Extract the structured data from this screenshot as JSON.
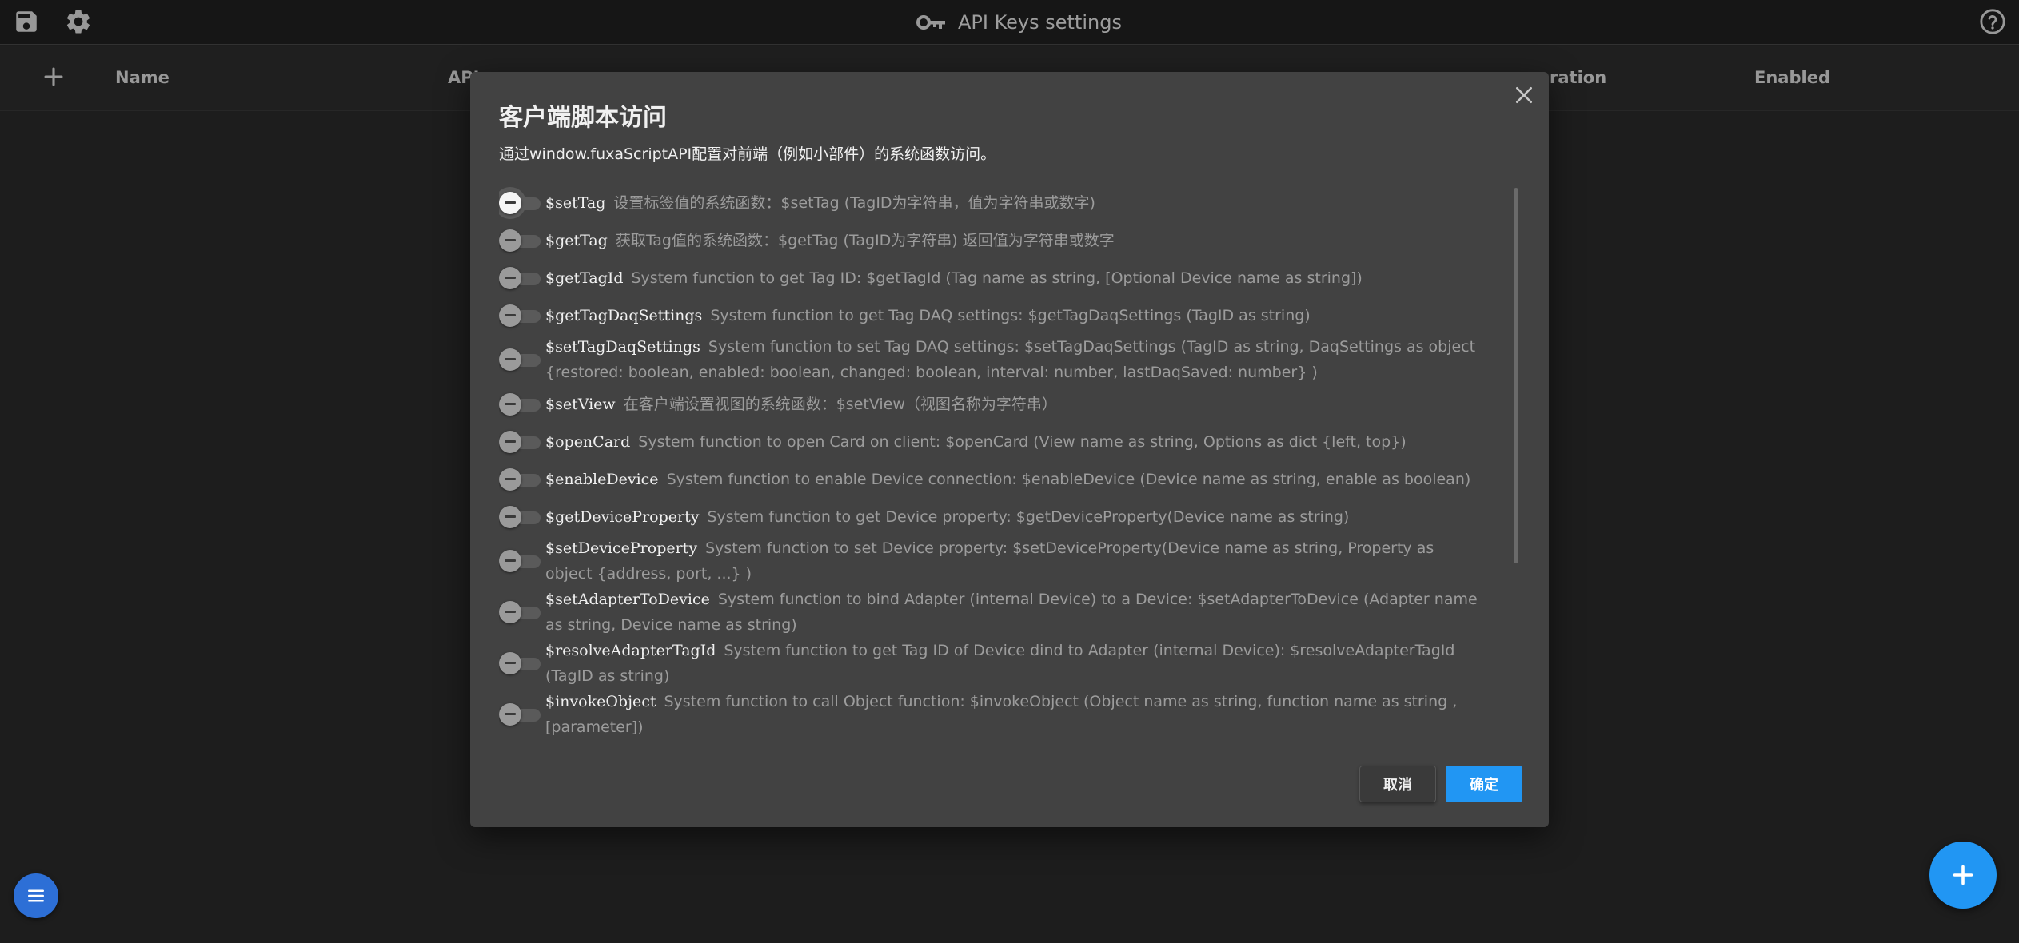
{
  "header": {
    "title": "API Keys settings",
    "icons": [
      "save-icon",
      "gear-icon",
      "key-icon",
      "help-icon"
    ]
  },
  "table": {
    "columns": [
      "Name",
      "API",
      "ration",
      "Enabled"
    ],
    "add_icon": "plus-icon"
  },
  "dialog": {
    "title": "客户端脚本访问",
    "description": "通过window.fuxaScriptAPI配置对前端（例如小部件）的系统函数访问。",
    "items": [
      {
        "name": "$setTag",
        "desc": "设置标签值的系统函数：$setTag (TagID为字符串，值为字符串或数字)",
        "enabled": false
      },
      {
        "name": "$getTag",
        "desc": "获取Tag值的系统函数：$getTag (TagID为字符串) 返回值为字符串或数字",
        "enabled": false
      },
      {
        "name": "$getTagId",
        "desc": "System function to get Tag ID: $getTagId (Tag name as string, [Optional Device name as string])",
        "enabled": false
      },
      {
        "name": "$getTagDaqSettings",
        "desc": "System function to get Tag DAQ settings: $getTagDaqSettings (TagID as string)",
        "enabled": false
      },
      {
        "name": "$setTagDaqSettings",
        "desc": "System function to set Tag DAQ settings: $setTagDaqSettings (TagID as string, DaqSettings as object {restored: boolean, enabled: boolean, changed: boolean, interval: number, lastDaqSaved: number} )",
        "enabled": false
      },
      {
        "name": "$setView",
        "desc": "在客户端设置视图的系统函数：$setView（视图名称为字符串）",
        "enabled": false
      },
      {
        "name": "$openCard",
        "desc": "System function to open Card on client: $openCard (View name as string, Options as dict {left, top})",
        "enabled": false
      },
      {
        "name": "$enableDevice",
        "desc": "System function to enable Device connection: $enableDevice (Device name as string, enable as boolean)",
        "enabled": false
      },
      {
        "name": "$getDeviceProperty",
        "desc": "System function to get Device property: $getDeviceProperty(Device name as string)",
        "enabled": false
      },
      {
        "name": "$setDeviceProperty",
        "desc": "System function to set Device property: $setDeviceProperty(Device name as string, Property as object {address, port, ...} )",
        "enabled": false
      },
      {
        "name": "$setAdapterToDevice",
        "desc": "System function to bind Adapter (internal Device) to a Device: $setAdapterToDevice (Adapter name as string, Device name as string)",
        "enabled": false
      },
      {
        "name": "$resolveAdapterTagId",
        "desc": "System function to get Tag ID of Device dind to Adapter (internal Device): $resolveAdapterTagId (TagID as string)",
        "enabled": false
      },
      {
        "name": "$invokeObject",
        "desc": "System function to call Object function: $invokeObject (Object name as string, function name as string , [parameter])",
        "enabled": false
      }
    ],
    "cancel_label": "取消",
    "ok_label": "确定"
  },
  "colors": {
    "accent": "#2196f3",
    "background": "#2b2b2b",
    "dialog": "#424242"
  }
}
